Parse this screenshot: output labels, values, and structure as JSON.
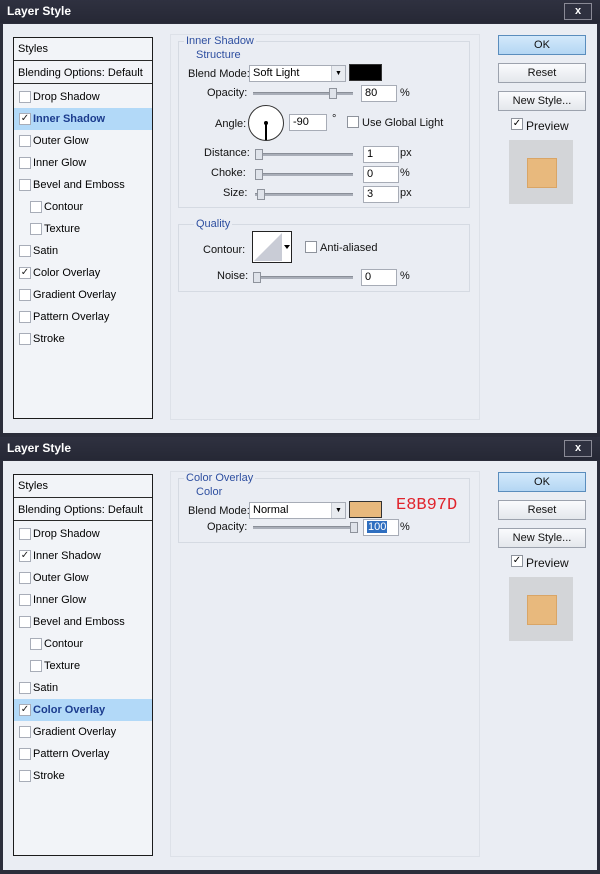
{
  "dialogs": [
    {
      "title": "Layer Style",
      "close_glyph": "x",
      "styles_header": "Styles",
      "blending_options": "Blending Options: Default",
      "style_items": [
        {
          "label": "Drop Shadow",
          "checked": false,
          "selected": false,
          "indent": false
        },
        {
          "label": "Inner Shadow",
          "checked": true,
          "selected": true,
          "indent": false
        },
        {
          "label": "Outer Glow",
          "checked": false,
          "selected": false,
          "indent": false
        },
        {
          "label": "Inner Glow",
          "checked": false,
          "selected": false,
          "indent": false
        },
        {
          "label": "Bevel and Emboss",
          "checked": false,
          "selected": false,
          "indent": false
        },
        {
          "label": "Contour",
          "checked": false,
          "selected": false,
          "indent": true
        },
        {
          "label": "Texture",
          "checked": false,
          "selected": false,
          "indent": true
        },
        {
          "label": "Satin",
          "checked": false,
          "selected": false,
          "indent": false
        },
        {
          "label": "Color Overlay",
          "checked": true,
          "selected": false,
          "indent": false
        },
        {
          "label": "Gradient Overlay",
          "checked": false,
          "selected": false,
          "indent": false
        },
        {
          "label": "Pattern Overlay",
          "checked": false,
          "selected": false,
          "indent": false
        },
        {
          "label": "Stroke",
          "checked": false,
          "selected": false,
          "indent": false
        }
      ],
      "panel_title": "Inner Shadow",
      "structure_title": "Structure",
      "blend_mode_label": "Blend Mode:",
      "blend_mode_value": "Soft Light",
      "shadow_color": "#000000",
      "opacity_label": "Opacity:",
      "opacity_value": "80",
      "opacity_unit": "%",
      "angle_label": "Angle:",
      "angle_value": "-90",
      "angle_unit": "°",
      "global_light_label": "Use Global Light",
      "global_light_checked": false,
      "distance_label": "Distance:",
      "distance_value": "1",
      "distance_unit": "px",
      "choke_label": "Choke:",
      "choke_value": "0",
      "choke_unit": "%",
      "size_label": "Size:",
      "size_value": "3",
      "size_unit": "px",
      "quality_title": "Quality",
      "contour_label": "Contour:",
      "anti_aliased_label": "Anti-aliased",
      "anti_aliased_checked": false,
      "noise_label": "Noise:",
      "noise_value": "0",
      "noise_unit": "%",
      "ok_label": "OK",
      "reset_label": "Reset",
      "new_style_label": "New Style...",
      "preview_label": "Preview",
      "preview_checked": true,
      "preview_fill": "#e8b97d"
    },
    {
      "title": "Layer Style",
      "close_glyph": "x",
      "styles_header": "Styles",
      "blending_options": "Blending Options: Default",
      "style_items": [
        {
          "label": "Drop Shadow",
          "checked": false,
          "selected": false,
          "indent": false
        },
        {
          "label": "Inner Shadow",
          "checked": true,
          "selected": false,
          "indent": false
        },
        {
          "label": "Outer Glow",
          "checked": false,
          "selected": false,
          "indent": false
        },
        {
          "label": "Inner Glow",
          "checked": false,
          "selected": false,
          "indent": false
        },
        {
          "label": "Bevel and Emboss",
          "checked": false,
          "selected": false,
          "indent": false
        },
        {
          "label": "Contour",
          "checked": false,
          "selected": false,
          "indent": true
        },
        {
          "label": "Texture",
          "checked": false,
          "selected": false,
          "indent": true
        },
        {
          "label": "Satin",
          "checked": false,
          "selected": false,
          "indent": false
        },
        {
          "label": "Color Overlay",
          "checked": true,
          "selected": true,
          "indent": false
        },
        {
          "label": "Gradient Overlay",
          "checked": false,
          "selected": false,
          "indent": false
        },
        {
          "label": "Pattern Overlay",
          "checked": false,
          "selected": false,
          "indent": false
        },
        {
          "label": "Stroke",
          "checked": false,
          "selected": false,
          "indent": false
        }
      ],
      "panel_title": "Color Overlay",
      "color_title": "Color",
      "blend_mode_label": "Blend Mode:",
      "blend_mode_value": "Normal",
      "overlay_color": "#e8b97d",
      "hex_annotation": "E8B97D",
      "opacity_label": "Opacity:",
      "opacity_value": "100",
      "opacity_unit": "%",
      "ok_label": "OK",
      "reset_label": "Reset",
      "new_style_label": "New Style...",
      "preview_label": "Preview",
      "preview_checked": true,
      "preview_fill": "#e8b97d"
    }
  ]
}
